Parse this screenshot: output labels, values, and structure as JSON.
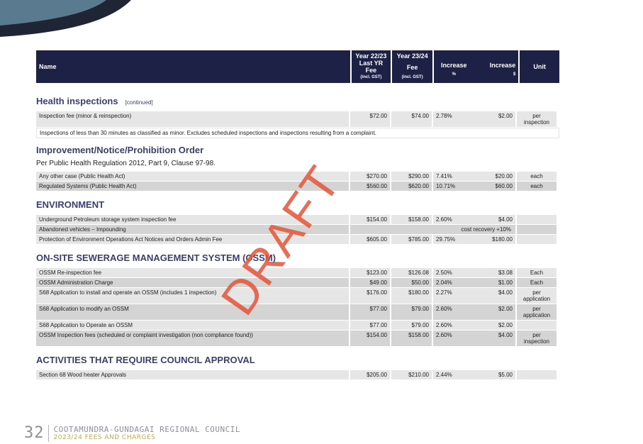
{
  "table_header": {
    "name": "Name",
    "last_year": [
      "Year 22/23",
      "Last YR",
      "Fee"
    ],
    "last_year_note": "(incl. GST)",
    "fee_top": "Year 23/24",
    "fee_mid": "Fee",
    "fee_note": "(incl. GST)",
    "increase_pct": "Increase",
    "increase_pct_sym": "%",
    "increase_dollar": "Increase",
    "increase_dollar_sym": "$",
    "unit": "Unit"
  },
  "sections": {
    "health": {
      "title": "Health inspections",
      "continued": "[continued]",
      "rows": [
        {
          "name": "Inspection fee (minor & reinspection)",
          "last": "$72.00",
          "fee": "$74.00",
          "pct": "2.78%",
          "inc": "$2.00",
          "unit": "per inspection"
        }
      ],
      "note": "Inspections of less than 30 minutes as classified as minor. Excludes scheduled inspections and inspections resulting from a complaint."
    },
    "improvement": {
      "title": "Improvement/Notice/Prohibition Order",
      "subtitle": "Per Public Health Regulation 2012, Part 9, Clause 97-98.",
      "rows": [
        {
          "name": "Any other case (Public Health Act)",
          "last": "$270.00",
          "fee": "$290.00",
          "pct": "7.41%",
          "inc": "$20.00",
          "unit": "each"
        },
        {
          "name": "Regulated Systems (Public Health Act)",
          "last": "$560.00",
          "fee": "$620.00",
          "pct": "10.71%",
          "inc": "$60.00",
          "unit": "each"
        }
      ]
    },
    "environment": {
      "title": "ENVIRONMENT",
      "rows": [
        {
          "name": "Underground Petroleum storage system inspection fee",
          "last": "$154.00",
          "fee": "$158.00",
          "pct": "2.60%",
          "inc": "$4.00",
          "unit": ""
        },
        {
          "name": "Abandoned vehicles – Impounding",
          "span": "cost recovery +10%",
          "unit": ""
        },
        {
          "name": "Protection of Environment Operations Act Notices and Orders Admin Fee",
          "last": "$605.00",
          "fee": "$785.00",
          "pct": "29.75%",
          "inc": "$180.00",
          "unit": ""
        }
      ]
    },
    "ossm": {
      "title": "ON-SITE SEWERAGE MANAGEMENT SYSTEM (OSSM)",
      "rows": [
        {
          "name": "OSSM Re-inspection fee",
          "last": "$123.00",
          "fee": "$126.08",
          "pct": "2.50%",
          "inc": "$3.08",
          "unit": "Each"
        },
        {
          "name": "OSSM Administration Charge",
          "last": "$49.00",
          "fee": "$50.00",
          "pct": "2.04%",
          "inc": "$1.00",
          "unit": "Each"
        },
        {
          "name": "S68 Application to install and operate an OSSM (includes 1 inspection)",
          "last": "$176.00",
          "fee": "$180.00",
          "pct": "2.27%",
          "inc": "$4.00",
          "unit": "per application"
        },
        {
          "name": "S68 Application to modify an OSSM",
          "last": "$77.00",
          "fee": "$79.00",
          "pct": "2.60%",
          "inc": "$2.00",
          "unit": "per application"
        },
        {
          "name": "S68 Application to Operate an OSSM",
          "last": "$77.00",
          "fee": "$79.00",
          "pct": "2.60%",
          "inc": "$2.00",
          "unit": ""
        },
        {
          "name": "OSSM Inspection fees (scheduled or complaint investigation (non compliance found))",
          "last": "$154.00",
          "fee": "$158.00",
          "pct": "2.60%",
          "inc": "$4.00",
          "unit": "per inspection"
        }
      ]
    },
    "activities": {
      "title": "ACTIVITIES THAT REQUIRE COUNCIL APPROVAL",
      "rows": [
        {
          "name": "Section 68 Wood heater Approvals",
          "last": "$205.00",
          "fee": "$210.00",
          "pct": "2.44%",
          "inc": "$5.00",
          "unit": ""
        }
      ]
    }
  },
  "watermark": "DRAFT",
  "footer": {
    "page_number": "32",
    "council": "COOTAMUNDRA-GUNDAGAI REGIONAL COUNCIL",
    "document": "2023/24 FEES AND CHARGES"
  },
  "colors": {
    "header_bg": "#1c2145",
    "heading": "#3a3f6e",
    "watermark": "#e4543a",
    "footer_gold": "#c8a64a"
  }
}
